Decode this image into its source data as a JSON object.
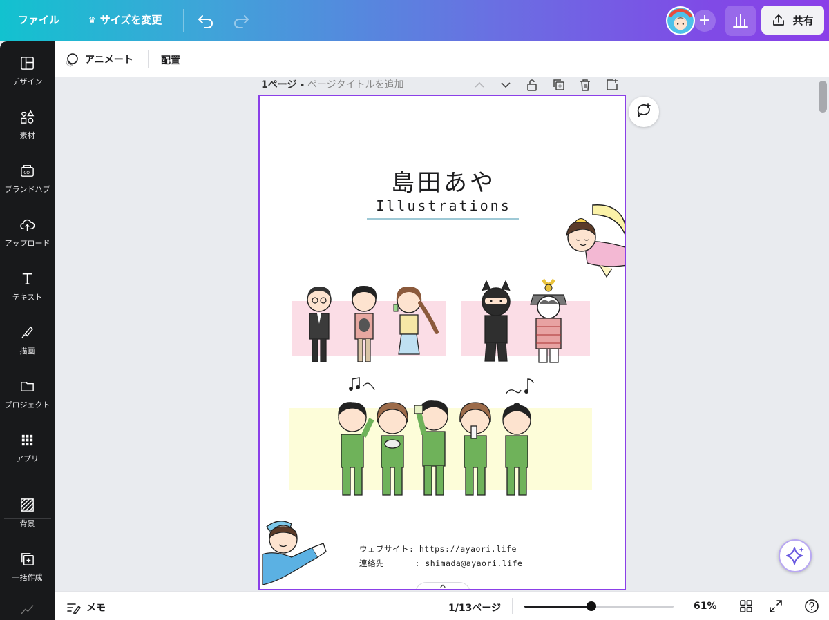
{
  "topbar": {
    "file_label": "ファイル",
    "resize_label": "サイズを変更",
    "share_label": "共有"
  },
  "sidebar": {
    "items": [
      {
        "label": "デザイン",
        "icon": "layout-icon"
      },
      {
        "label": "素材",
        "icon": "shapes-icon"
      },
      {
        "label": "ブランドハブ",
        "icon": "brand-icon"
      },
      {
        "label": "アップロード",
        "icon": "upload-cloud-icon"
      },
      {
        "label": "テキスト",
        "icon": "text-icon"
      },
      {
        "label": "描画",
        "icon": "draw-icon"
      },
      {
        "label": "プロジェクト",
        "icon": "folder-icon"
      },
      {
        "label": "アプリ",
        "icon": "apps-grid-icon"
      },
      {
        "label": "背景",
        "icon": "background-icon"
      },
      {
        "label": "一括作成",
        "icon": "bulk-create-icon"
      }
    ]
  },
  "context_bar": {
    "animate_label": "アニメート",
    "arrange_label": "配置"
  },
  "page_header": {
    "page_label": "1ページ - ",
    "title_placeholder": "ページタイトルを追加"
  },
  "design": {
    "title_jp": "島田あや",
    "title_en": "Illustrations",
    "website_line": "ウェブサイト: https://ayaori.life",
    "contact_line": "連絡先      : shimada@ayaori.life"
  },
  "bottombar": {
    "memo_label": "メモ",
    "page_counter": "1/13ページ",
    "zoom_label": "61%",
    "zoom_fraction": 0.45
  },
  "colors": {
    "accent": "#8b3fe8",
    "pink_band": "#fbdde6",
    "yellow_band": "#fdfdd9",
    "tracksuit_green": "#6fb25a"
  }
}
